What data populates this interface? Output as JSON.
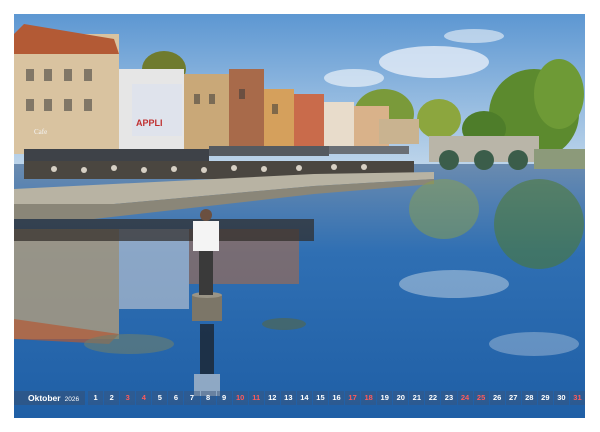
{
  "calendar": {
    "month": "Oktober",
    "year": "2026",
    "weekend_color": "#ff5a5a",
    "days": [
      {
        "n": "1",
        "we": false
      },
      {
        "n": "2",
        "we": false
      },
      {
        "n": "3",
        "we": true
      },
      {
        "n": "4",
        "we": true
      },
      {
        "n": "5",
        "we": false
      },
      {
        "n": "6",
        "we": false
      },
      {
        "n": "7",
        "we": false
      },
      {
        "n": "8",
        "we": false
      },
      {
        "n": "9",
        "we": false
      },
      {
        "n": "10",
        "we": true
      },
      {
        "n": "11",
        "we": true
      },
      {
        "n": "12",
        "we": false
      },
      {
        "n": "13",
        "we": false
      },
      {
        "n": "14",
        "we": false
      },
      {
        "n": "15",
        "we": false
      },
      {
        "n": "16",
        "we": false
      },
      {
        "n": "17",
        "we": true
      },
      {
        "n": "18",
        "we": true
      },
      {
        "n": "19",
        "we": false
      },
      {
        "n": "20",
        "we": false
      },
      {
        "n": "21",
        "we": false
      },
      {
        "n": "22",
        "we": false
      },
      {
        "n": "23",
        "we": false
      },
      {
        "n": "24",
        "we": true
      },
      {
        "n": "25",
        "we": true
      },
      {
        "n": "26",
        "we": false
      },
      {
        "n": "27",
        "we": false
      },
      {
        "n": "28",
        "we": false
      },
      {
        "n": "29",
        "we": false
      },
      {
        "n": "30",
        "we": false
      },
      {
        "n": "31",
        "we": true
      }
    ]
  },
  "photo": {
    "banner_text": "APPLI",
    "sign_text": "Cafe",
    "sky_color": "#6fa6d8",
    "water_color": "#2e72b8"
  }
}
